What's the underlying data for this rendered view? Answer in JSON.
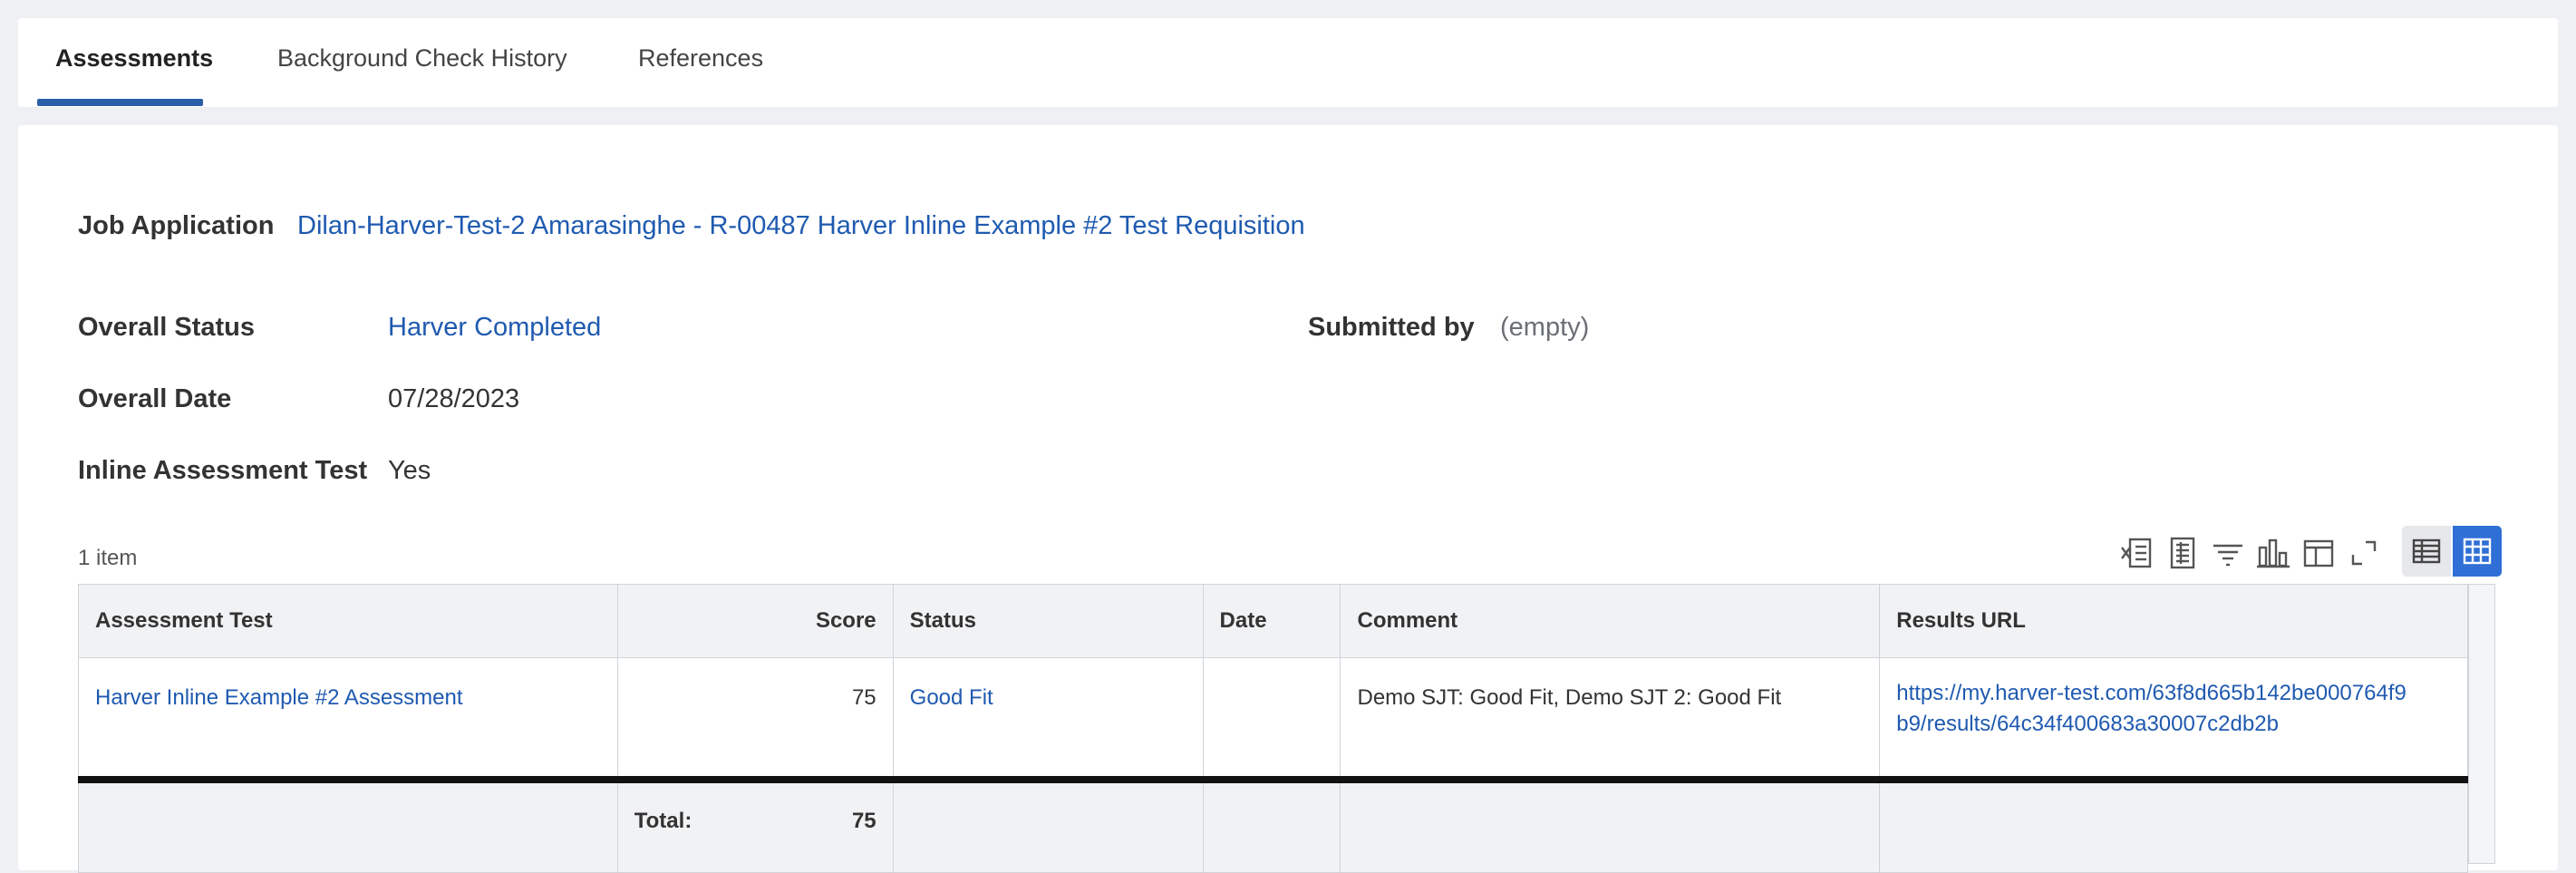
{
  "tabs": [
    {
      "label": "Assessments",
      "active": true
    },
    {
      "label": "Background Check History",
      "active": false
    },
    {
      "label": "References",
      "active": false
    }
  ],
  "fields": {
    "job_application": {
      "label": "Job Application",
      "value": "Dilan-Harver-Test-2 Amarasinghe - R-00487 Harver Inline Example #2 Test Requisition"
    },
    "overall_status": {
      "label": "Overall Status",
      "value": "Harver Completed"
    },
    "submitted_by": {
      "label": "Submitted by",
      "value": "(empty)"
    },
    "overall_date": {
      "label": "Overall Date",
      "value": "07/28/2023"
    },
    "inline_test": {
      "label": "Inline Assessment Test",
      "value": "Yes"
    }
  },
  "grid": {
    "item_count": "1 item",
    "columns": [
      "Assessment Test",
      "Score",
      "Status",
      "Date",
      "Comment",
      "Results URL"
    ],
    "rows": [
      {
        "assessment_test": "Harver Inline Example #2 Assessment",
        "score": "75",
        "status": "Good Fit",
        "date": "",
        "comment": "Demo SJT: Good Fit, Demo SJT 2: Good Fit",
        "results_url_line1": "https://my.harver-test.com/63f8d665b142be000764f9",
        "results_url_line2": "b9/results/64c34f400683a30007c2db2b"
      }
    ],
    "total_label": "Total:",
    "total_score": "75"
  },
  "toolbar_icons": [
    "export-excel-icon",
    "export-pdf-icon",
    "filter-icon",
    "chart-icon",
    "configure-columns-icon",
    "fullscreen-icon"
  ],
  "colors": {
    "link": "#1f5ab0",
    "accent": "#2f6fd6",
    "tab_underline": "#2a5fa8"
  }
}
